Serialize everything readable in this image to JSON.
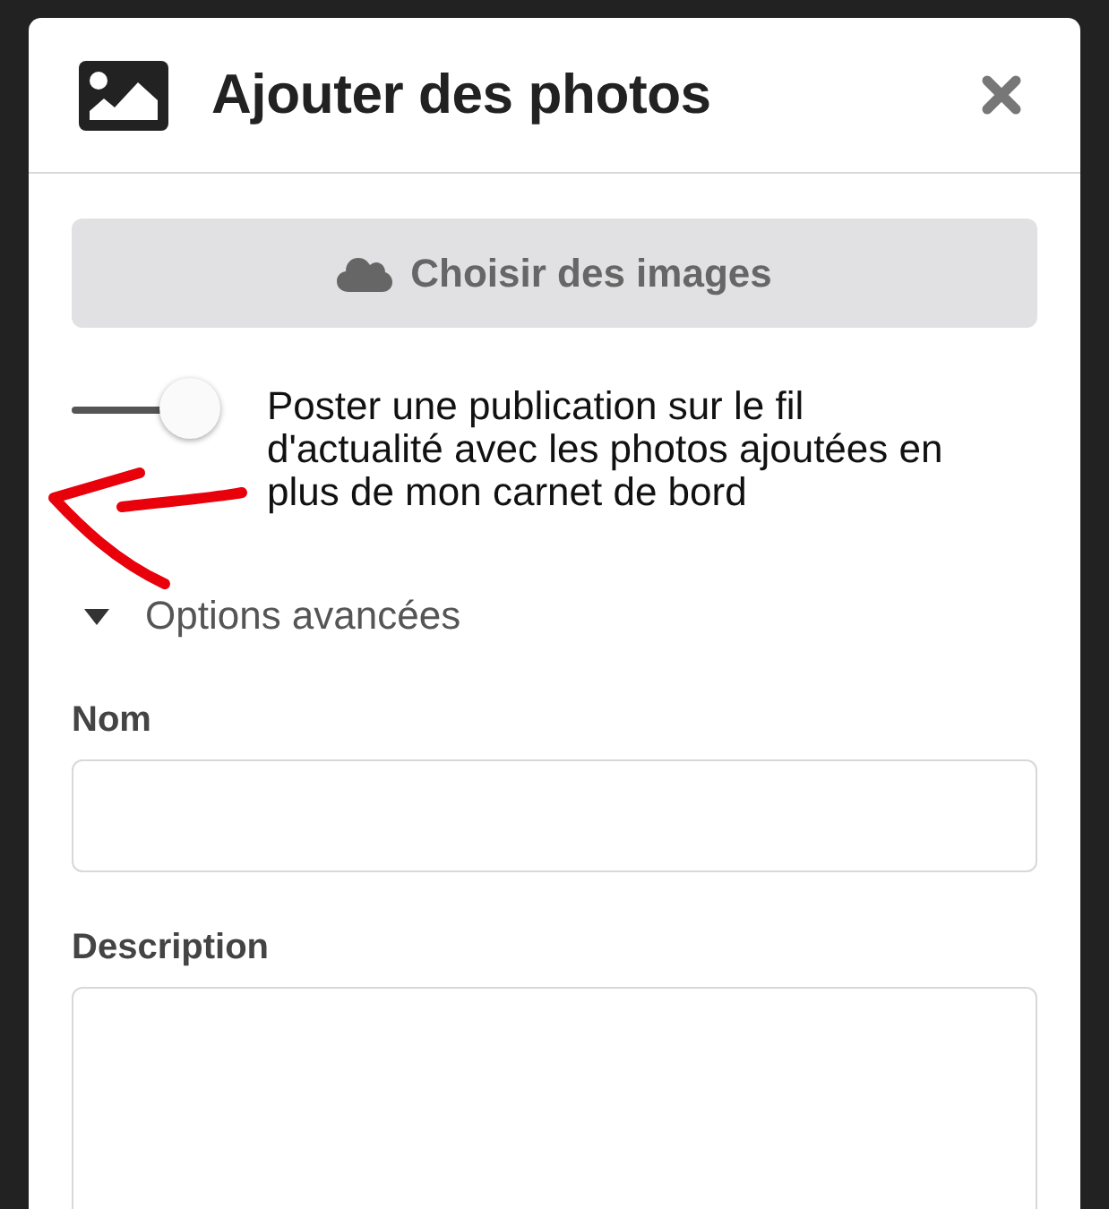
{
  "dialog": {
    "title": "Ajouter des photos",
    "choose_button": {
      "label": "Choisir des images"
    },
    "toggle": {
      "on": true,
      "label": "Poster une publication sur le fil d'actualité avec les photos ajoutées en plus de mon carnet de bord"
    },
    "advanced_options": {
      "label": "Options avancées",
      "expanded": true
    },
    "fields": [
      {
        "kind": "input",
        "label": "Nom"
      },
      {
        "kind": "textarea",
        "label": "Description"
      }
    ]
  }
}
